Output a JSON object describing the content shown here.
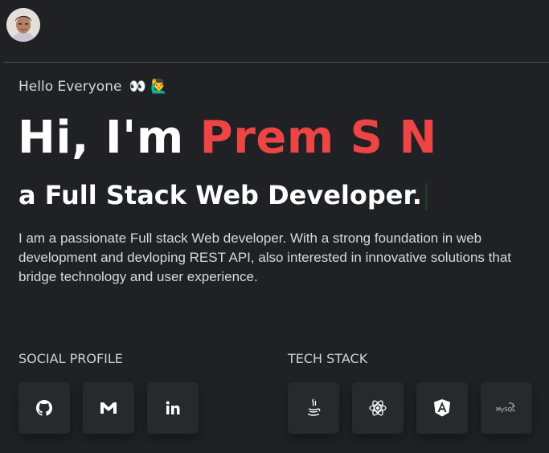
{
  "header": {
    "avatar_icon": "profile-photo"
  },
  "hero": {
    "greeting": "Hello Everyone",
    "greeting_emojis": "👀 🙋‍♂️",
    "headline_prefix": "Hi, I'm ",
    "name": "Prem S N",
    "name_color": "#ee4444",
    "role": "a Full Stack Web Developer.",
    "intro": "I am a passionate Full stack Web developer. With a strong foundation in web development and devloping REST API, also interested in innovative solutions that bridge technology and user experience."
  },
  "social": {
    "title": "SOCIAL PROFILE",
    "items": [
      {
        "icon": "github-icon"
      },
      {
        "icon": "gmail-icon"
      },
      {
        "icon": "linkedin-icon"
      }
    ]
  },
  "tech": {
    "title": "TECH STACK",
    "items": [
      {
        "icon": "java-icon"
      },
      {
        "icon": "react-icon"
      },
      {
        "icon": "angular-icon"
      },
      {
        "icon": "mysql-icon",
        "label": "MySQL"
      }
    ]
  },
  "colors": {
    "background": "#1f2125",
    "accent": "#ee4444",
    "tile": "#27292d"
  }
}
